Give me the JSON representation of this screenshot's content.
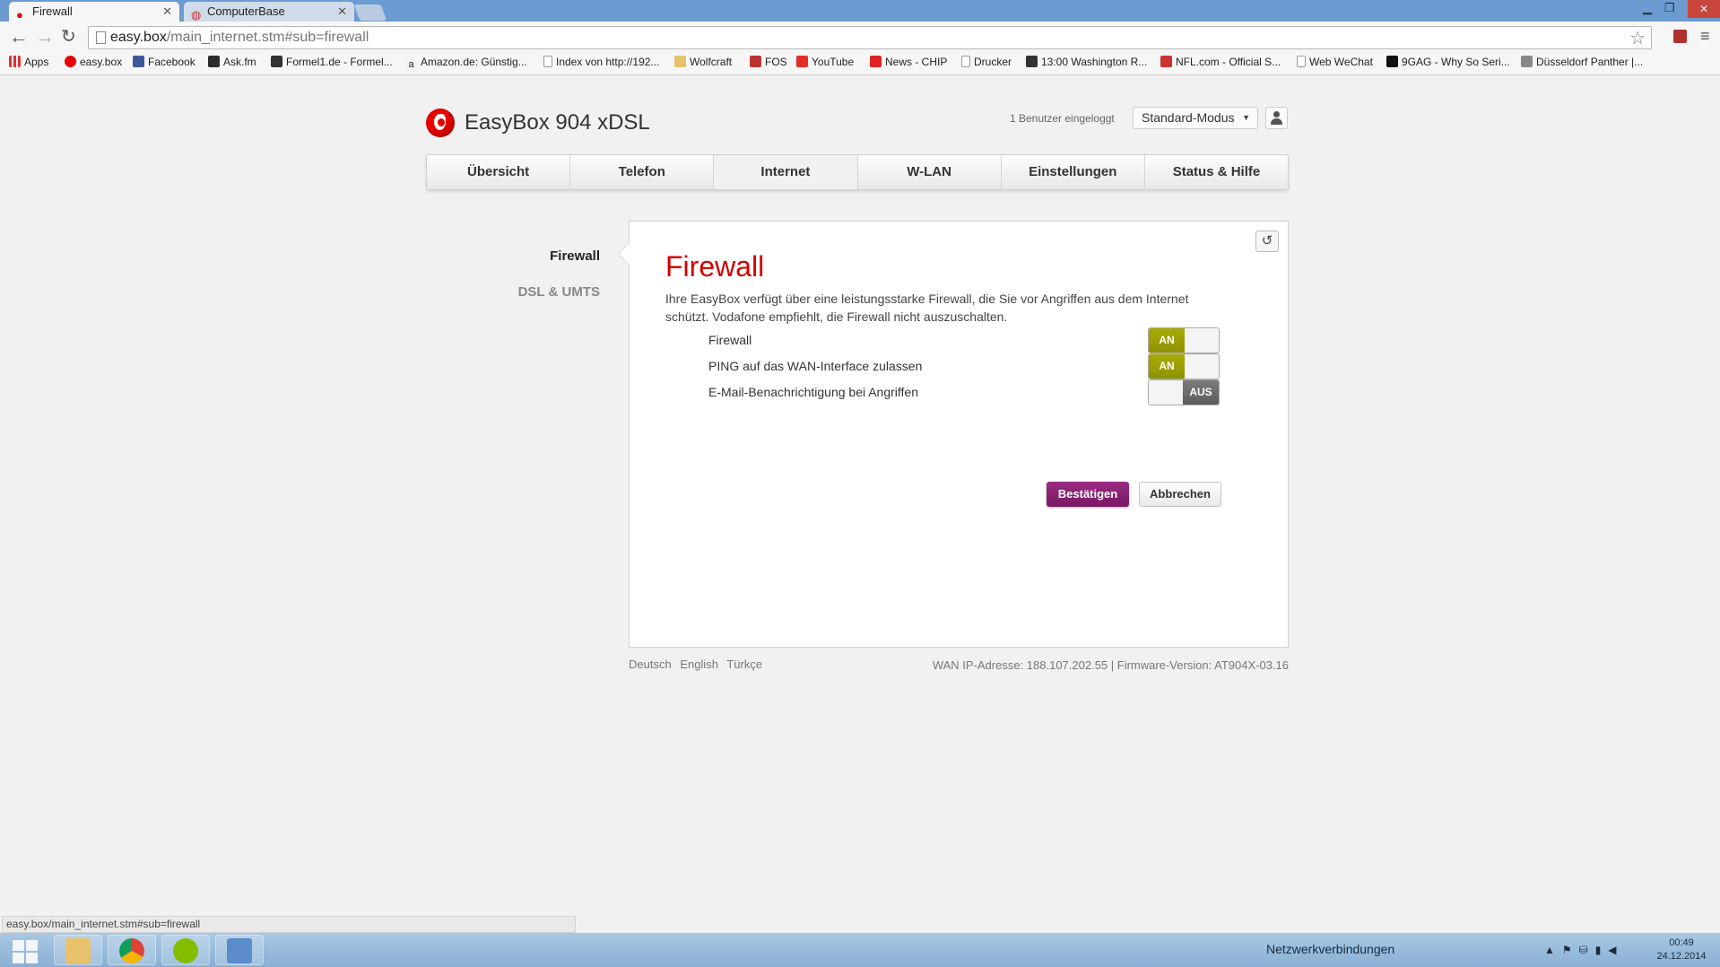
{
  "browser": {
    "tabs": [
      {
        "title": "Firewall",
        "active": true,
        "icon": "vodafone-icon"
      },
      {
        "title": "ComputerBase",
        "active": false,
        "icon": "computerbase-icon"
      }
    ],
    "url_host": "easy.box",
    "url_path": "/main_internet.stm#sub=firewall",
    "bookmarks": [
      "Apps",
      "easy.box",
      "Facebook",
      "Ask.fm",
      "Formel1.de - Formel...",
      "Amazon.de: Günstig...",
      "Index von http://192...",
      "Wolfcraft",
      "FOS",
      "YouTube",
      "News - CHIP",
      "Drucker",
      "13:00 Washington R...",
      "NFL.com - Official S...",
      "Web WeChat",
      "9GAG - Why So Seri...",
      "Düsseldorf Panther |..."
    ],
    "status_url": "easy.box/main_internet.stm#sub=firewall"
  },
  "header": {
    "product": "EasyBox 904 xDSL",
    "users_logged_in": "1 Benutzer eingeloggt",
    "mode": "Standard-Modus"
  },
  "nav": {
    "tabs": [
      "Übersicht",
      "Telefon",
      "Internet",
      "W-LAN",
      "Einstellungen",
      "Status & Hilfe"
    ],
    "active": "Internet"
  },
  "subnav": {
    "items": [
      "Firewall",
      "DSL & UMTS"
    ],
    "active": "Firewall"
  },
  "panel": {
    "title": "Firewall",
    "description": "Ihre EasyBox verfügt über eine leistungsstarke Firewall, die Sie vor Angriffen aus dem Internet schützt. Vodafone empfiehlt, die Firewall nicht auszuschalten.",
    "settings": [
      {
        "label": "Firewall",
        "state": "AN"
      },
      {
        "label": "PING auf das WAN-Interface zulassen",
        "state": "AN"
      },
      {
        "label": "E-Mail-Benachrichtigung bei Angriffen",
        "state": "AUS"
      }
    ],
    "confirm_label": "Bestätigen",
    "cancel_label": "Abbrechen"
  },
  "footer": {
    "languages": [
      "Deutsch",
      "English",
      "Türkçe"
    ],
    "info": "WAN IP-Adresse: 188.107.202.55 | Firmware-Version: AT904X-03.16"
  },
  "taskbar": {
    "tray_label": "Netzwerkverbindungen",
    "time": "00:49",
    "date": "24.12.2014"
  },
  "colors": {
    "accent_red": "#d40000",
    "toggle_on": "#9a9d00",
    "toggle_off": "#6a6a6a",
    "confirm_button": "#8a2275"
  }
}
